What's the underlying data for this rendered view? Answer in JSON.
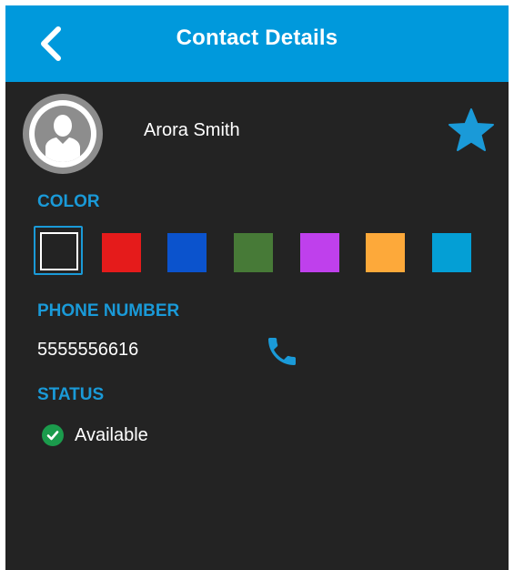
{
  "header": {
    "title": "Contact Details",
    "back_icon": "chevron-left-icon",
    "background": "#0099dc"
  },
  "contact": {
    "name": "Arora Smith",
    "avatar_icon": "person-avatar-icon",
    "favorite_icon": "star-icon",
    "favorite_color": "#1a9ad8",
    "favorite": true
  },
  "color_section": {
    "label": "COLOR",
    "selected_index": 0,
    "swatches": [
      {
        "name": "none",
        "hex": "transparent"
      },
      {
        "name": "red",
        "hex": "#e51b1b"
      },
      {
        "name": "blue",
        "hex": "#0b53cd"
      },
      {
        "name": "green",
        "hex": "#477a37"
      },
      {
        "name": "purple",
        "hex": "#bf40ec"
      },
      {
        "name": "orange",
        "hex": "#fda93a"
      },
      {
        "name": "light-blue",
        "hex": "#049fd5"
      }
    ]
  },
  "phone_section": {
    "label": "PHONE NUMBER",
    "number": "5555556616",
    "call_icon": "phone-icon"
  },
  "status_section": {
    "label": "STATUS",
    "status": "Available",
    "status_icon": "check-circle-icon",
    "status_color": "#1b9b4c"
  },
  "theme": {
    "background": "#232323",
    "accent": "#1a9ad8"
  }
}
